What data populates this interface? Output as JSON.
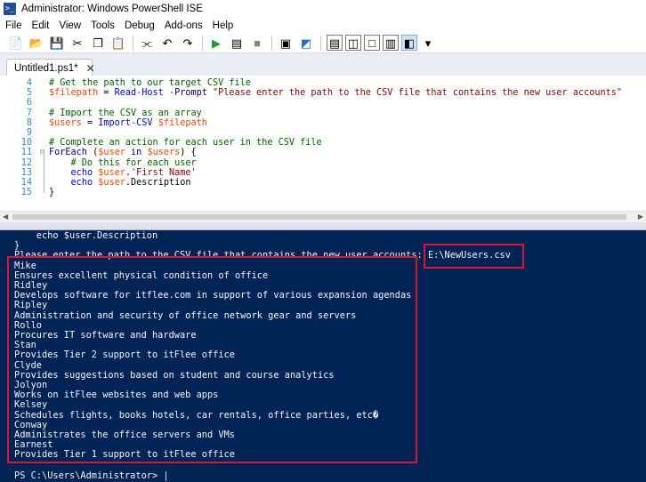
{
  "window": {
    "title": "Administrator: Windows PowerShell ISE",
    "icon_glyph": ">_"
  },
  "menu": [
    "File",
    "Edit",
    "View",
    "Tools",
    "Debug",
    "Add-ons",
    "Help"
  ],
  "toolbar": {
    "buttons": [
      {
        "name": "new-icon",
        "glyph": "📄"
      },
      {
        "name": "open-icon",
        "glyph": "📂"
      },
      {
        "name": "save-icon",
        "glyph": "💾"
      },
      {
        "name": "cut-icon",
        "glyph": "✂"
      },
      {
        "name": "copy-icon",
        "glyph": "❐"
      },
      {
        "name": "paste-icon",
        "glyph": "📋"
      },
      {
        "name": "clear-console-icon",
        "glyph": "⫘"
      },
      {
        "name": "undo-icon",
        "glyph": "↶"
      },
      {
        "name": "redo-icon",
        "glyph": "↷"
      },
      {
        "name": "run-icon",
        "glyph": "▶"
      },
      {
        "name": "run-selection-icon",
        "glyph": "▤"
      },
      {
        "name": "stop-icon",
        "glyph": "■"
      },
      {
        "name": "remote-powershell-icon",
        "glyph": "▣"
      },
      {
        "name": "start-powershell-icon",
        "glyph": "◩"
      },
      {
        "name": "show-script-top-icon",
        "glyph": "▤"
      },
      {
        "name": "show-script-right-icon",
        "glyph": "◫"
      },
      {
        "name": "show-script-maximized-icon",
        "glyph": "□"
      },
      {
        "name": "show-command-window-icon",
        "glyph": "▥"
      },
      {
        "name": "show-command-addon-icon",
        "glyph": "◧"
      },
      {
        "name": "toolbar-overflow-icon",
        "glyph": "▾"
      }
    ]
  },
  "tab": {
    "label": "Untitled1.ps1*",
    "close_glyph": "✕"
  },
  "editor": {
    "lines": [
      {
        "num": "4",
        "parts": [
          {
            "t": "# Get the path to our target CSV file",
            "c": "comment"
          }
        ]
      },
      {
        "num": "5",
        "parts": [
          {
            "t": "$filepath",
            "c": "var"
          },
          {
            "t": " = ",
            "c": "plain"
          },
          {
            "t": "Read-Host",
            "c": "cmd"
          },
          {
            "t": " -Prompt ",
            "c": "param"
          },
          {
            "t": "\"Please enter the path to the CSV file that contains the new user accounts\"",
            "c": "str"
          }
        ]
      },
      {
        "num": "6",
        "parts": []
      },
      {
        "num": "7",
        "parts": [
          {
            "t": "# Import the CSV as an array",
            "c": "comment"
          }
        ]
      },
      {
        "num": "8",
        "parts": [
          {
            "t": "$users",
            "c": "var"
          },
          {
            "t": " = ",
            "c": "plain"
          },
          {
            "t": "Import-CSV",
            "c": "cmd"
          },
          {
            "t": " ",
            "c": "plain"
          },
          {
            "t": "$filepath",
            "c": "var"
          }
        ]
      },
      {
        "num": "9",
        "parts": []
      },
      {
        "num": "10",
        "parts": [
          {
            "t": "# Complete an action for each user in the CSV file",
            "c": "comment"
          }
        ]
      },
      {
        "num": "11",
        "fold": "⊟",
        "parts": [
          {
            "t": "ForEach",
            "c": "kw"
          },
          {
            "t": " (",
            "c": "plain"
          },
          {
            "t": "$user",
            "c": "var"
          },
          {
            "t": " in ",
            "c": "kw"
          },
          {
            "t": "$users",
            "c": "var"
          },
          {
            "t": ") {",
            "c": "plain"
          }
        ]
      },
      {
        "num": "12",
        "parts": [
          {
            "t": "    # Do this for each user",
            "c": "comment"
          }
        ]
      },
      {
        "num": "13",
        "parts": [
          {
            "t": "    ",
            "c": "plain"
          },
          {
            "t": "echo",
            "c": "cmd"
          },
          {
            "t": " ",
            "c": "plain"
          },
          {
            "t": "$user",
            "c": "var"
          },
          {
            "t": ".",
            "c": "plain"
          },
          {
            "t": "'First Name'",
            "c": "str"
          }
        ]
      },
      {
        "num": "14",
        "parts": [
          {
            "t": "    ",
            "c": "plain"
          },
          {
            "t": "echo",
            "c": "cmd"
          },
          {
            "t": " ",
            "c": "plain"
          },
          {
            "t": "$user",
            "c": "var"
          },
          {
            "t": ".Description",
            "c": "plain"
          }
        ]
      },
      {
        "num": "15",
        "parts": [
          {
            "t": "}",
            "c": "plain"
          }
        ]
      }
    ]
  },
  "console": {
    "lines": [
      "    echo $user.Description",
      "}",
      "Please enter the path to the CSV file that contains the new user accounts: E:\\NewUsers.csv",
      "Mike",
      "Ensures excellent physical condition of office",
      "Ridley",
      "Develops software for itflee.com in support of various expansion agendas",
      "Ripley",
      "Administration and security of office network gear and servers",
      "Rollo",
      "Procures IT software and hardware",
      "Stan",
      "Provides Tier 2 support to itFlee office",
      "Clyde",
      "Provides suggestions based on student and course analytics",
      "Jolyon",
      "Works on itFlee websites and web apps",
      "Kelsey",
      "Schedules flights, books hotels, car rentals, office parties, etc�",
      "Conway",
      "Administrates the office servers and VMs",
      "Earnest",
      "Provides Tier 1 support to itFlee office",
      "",
      "PS C:\\Users\\Administrator> |"
    ]
  },
  "colors": {
    "console_bg": "#012456",
    "highlight": "#e0142c",
    "comment": "#006400",
    "variable": "#ff4500",
    "command": "#0000ff",
    "string": "#8b0000"
  }
}
